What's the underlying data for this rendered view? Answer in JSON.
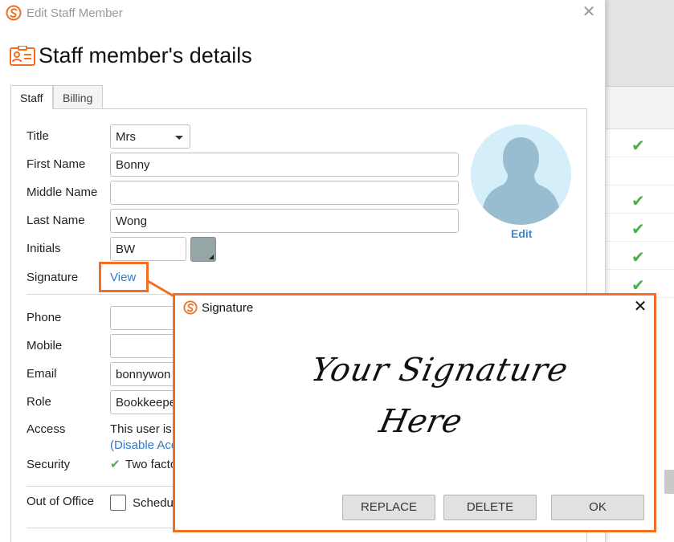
{
  "window": {
    "title": "Edit Staff Member",
    "heading": "Staff member's details"
  },
  "tabs": [
    {
      "label": "Staff",
      "active": true
    },
    {
      "label": "Billing",
      "active": false
    }
  ],
  "form": {
    "title_label": "Title",
    "title_value": "Mrs",
    "first_name_label": "First Name",
    "first_name_value": "Bonny",
    "middle_name_label": "Middle Name",
    "middle_name_value": "",
    "last_name_label": "Last Name",
    "last_name_value": "Wong",
    "initials_label": "Initials",
    "initials_value": "BW",
    "initials_color": "#96a5a6",
    "signature_label": "Signature",
    "signature_link": "View",
    "phone_label": "Phone",
    "phone_value": "",
    "mobile_label": "Mobile",
    "mobile_value": "",
    "email_label": "Email",
    "email_value": "bonnywon",
    "role_label": "Role",
    "role_value": "Bookkeepe",
    "access_label": "Access",
    "access_text": "This user is",
    "access_link": "(Disable Acc",
    "security_label": "Security",
    "security_text": "Two facto",
    "out_of_office_label": "Out of Office",
    "out_of_office_checkbox_label": "Schedu"
  },
  "avatar": {
    "edit_label": "Edit"
  },
  "signature_dialog": {
    "title": "Signature",
    "signature_line1": "Your Signature",
    "signature_line2": "Here",
    "replace_label": "REPLACE",
    "delete_label": "DELETE",
    "ok_label": "OK"
  },
  "colors": {
    "accent_orange": "#f26f21",
    "link_blue": "#2f7cc8",
    "check_green": "#4cae4c",
    "avatar_bg": "#d4eefa",
    "avatar_silhouette": "#99bdd0"
  }
}
